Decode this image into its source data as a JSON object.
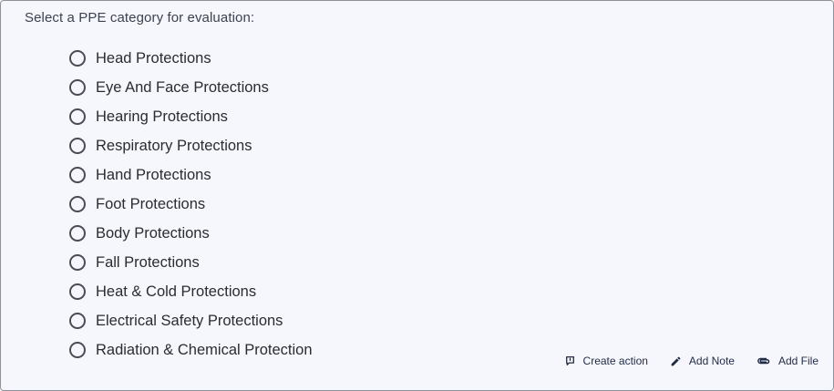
{
  "prompt": "Select a PPE category for evaluation:",
  "options": [
    {
      "label": "Head Protections"
    },
    {
      "label": "Eye And Face Protections"
    },
    {
      "label": "Hearing Protections"
    },
    {
      "label": "Respiratory Protections"
    },
    {
      "label": "Hand Protections"
    },
    {
      "label": "Foot Protections"
    },
    {
      "label": "Body Protections"
    },
    {
      "label": "Fall Protections"
    },
    {
      "label": "Heat & Cold Protections"
    },
    {
      "label": "Electrical Safety Protections"
    },
    {
      "label": "Radiation & Chemical Protection"
    }
  ],
  "actions": {
    "create_action": {
      "label": "Create action",
      "icon": "flag-icon"
    },
    "add_note": {
      "label": "Add Note",
      "icon": "pencil-icon"
    },
    "add_file": {
      "label": "Add File",
      "icon": "paperclip-icon"
    }
  },
  "colors": {
    "card_background": "#f6f7fc",
    "card_border": "#8e9199",
    "text": "#2a2c33",
    "action_text": "#1f2a44"
  }
}
